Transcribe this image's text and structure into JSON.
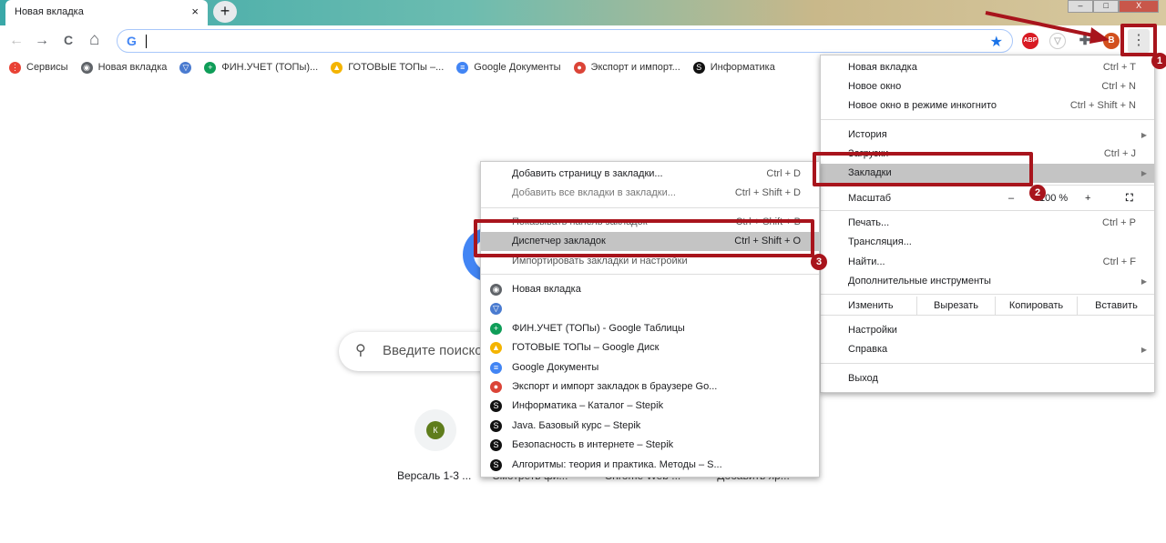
{
  "tab": {
    "title": "Новая вкладка",
    "close": "×",
    "new_tab": "+"
  },
  "window": {
    "minimize": "–",
    "maximize": "□",
    "close": "X"
  },
  "toolbar": {
    "back": "←",
    "forward": "→",
    "reload": "C",
    "home": "⌂",
    "omnibox_value": "",
    "google_icon": "G",
    "star": "★",
    "ext_abp": "ABP",
    "avatar": "B",
    "menu": "⋮"
  },
  "bookmarks_bar": [
    {
      "label": "Сервисы",
      "icon": "apps-icon",
      "color": "#e94235"
    },
    {
      "label": "Новая вкладка",
      "icon": "globe-icon",
      "color": "#5f6368"
    },
    {
      "label": "",
      "icon": "shield-icon",
      "color": "#4a7bd0"
    },
    {
      "label": "ФИН.УЧЕТ (ТОПы)...",
      "icon": "sheets-icon",
      "color": "#0f9d58"
    },
    {
      "label": "ГОТОВЫЕ ТОПы –...",
      "icon": "drive-icon",
      "color": "#f4b400"
    },
    {
      "label": "Google Документы",
      "icon": "docs-icon",
      "color": "#4285f4"
    },
    {
      "label": "Экспорт и импорт...",
      "icon": "chrome-icon",
      "color": "#db4437"
    },
    {
      "label": "Информатика",
      "icon": "stepik-icon",
      "color": "#111"
    }
  ],
  "main_menu": {
    "new_tab": {
      "label": "Новая вкладка",
      "shortcut": "Ctrl + T"
    },
    "new_window": {
      "label": "Новое окно",
      "shortcut": "Ctrl + N"
    },
    "incognito": {
      "label": "Новое окно в режиме инкогнито",
      "shortcut": "Ctrl + Shift + N"
    },
    "history": {
      "label": "История"
    },
    "downloads": {
      "label": "Загрузки",
      "shortcut": "Ctrl + J"
    },
    "bookmarks": {
      "label": "Закладки"
    },
    "zoom": {
      "label": "Масштаб",
      "minus": "–",
      "value": "100 %",
      "plus": "+"
    },
    "print": {
      "label": "Печать...",
      "shortcut": "Ctrl + P"
    },
    "cast": {
      "label": "Трансляция..."
    },
    "find": {
      "label": "Найти...",
      "shortcut": "Ctrl + F"
    },
    "more_tools": {
      "label": "Дополнительные инструменты"
    },
    "edit": {
      "label": "Изменить",
      "cut": "Вырезать",
      "copy": "Копировать",
      "paste": "Вставить"
    },
    "settings": {
      "label": "Настройки"
    },
    "help": {
      "label": "Справка"
    },
    "exit": {
      "label": "Выход"
    }
  },
  "bookmarks_submenu": {
    "add_page": {
      "label": "Добавить страницу в закладки...",
      "shortcut": "Ctrl + D"
    },
    "add_all": {
      "label": "Добавить все вкладки в закладки...",
      "shortcut": "Ctrl + Shift + D"
    },
    "show_bar": {
      "label": "Показывать панель закладок",
      "shortcut": "Ctrl + Shift + B"
    },
    "manager": {
      "label": "Диспетчер закладок",
      "shortcut": "Ctrl + Shift + O"
    },
    "import": {
      "label": "Импортировать закладки и настройки"
    },
    "items": [
      {
        "label": "Новая вкладка",
        "icon": "globe-icon",
        "color": "#5f6368"
      },
      {
        "label": "",
        "icon": "shield-icon",
        "color": "#4a7bd0"
      },
      {
        "label": "ФИН.УЧЕТ (ТОПы) - Google Таблицы",
        "icon": "sheets-icon",
        "color": "#0f9d58"
      },
      {
        "label": "ГОТОВЫЕ ТОПы – Google Диск",
        "icon": "drive-icon",
        "color": "#f4b400"
      },
      {
        "label": "Google Документы",
        "icon": "docs-icon",
        "color": "#4285f4"
      },
      {
        "label": "Экспорт и импорт закладок в браузере Go...",
        "icon": "chrome-icon",
        "color": "#db4437"
      },
      {
        "label": "Информатика – Каталог – Stepik",
        "icon": "stepik-icon",
        "color": "#111"
      },
      {
        "label": "Java. Базовый курс – Stepik",
        "icon": "stepik-icon",
        "color": "#111"
      },
      {
        "label": "Безопасность в интернете – Stepik",
        "icon": "stepik-icon",
        "color": "#111"
      },
      {
        "label": "Алгоритмы: теория и практика. Методы – S...",
        "icon": "stepik-icon",
        "color": "#111"
      }
    ]
  },
  "ntp": {
    "search_placeholder": "Введите поиско",
    "shortcut_letter": "К",
    "shortcut_label": "Версаль 1-3 ...",
    "hidden_labels": [
      "Смотреть фи...",
      "Chrome Web ...",
      "Добавить яр..."
    ]
  },
  "annotations": [
    "1",
    "2",
    "3"
  ],
  "accent_color": "#a8141c"
}
